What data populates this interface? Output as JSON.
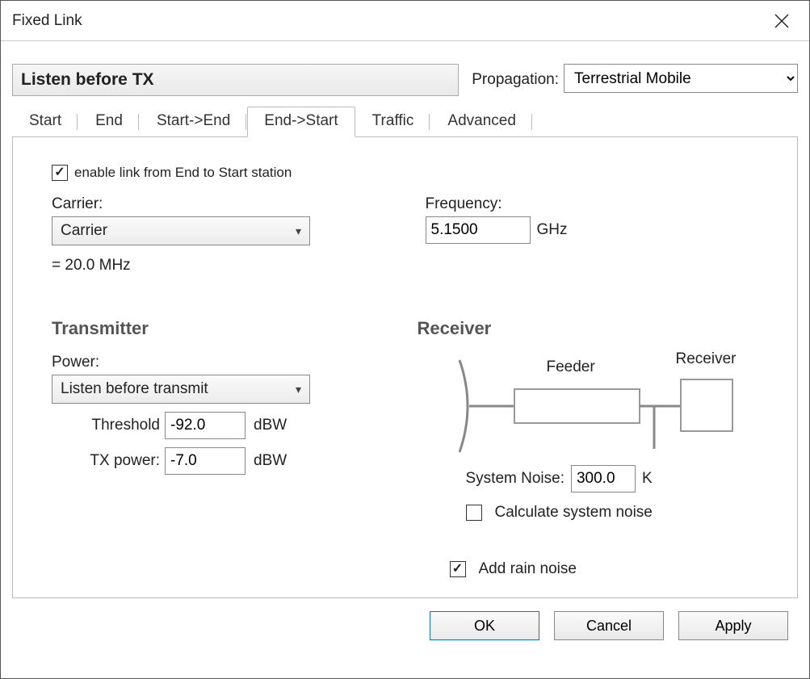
{
  "window": {
    "title": "Fixed Link"
  },
  "header": {
    "link_name": "Listen before TX",
    "propagation_label": "Propagation:",
    "propagation_value": "Terrestrial Mobile"
  },
  "tabs": [
    {
      "label": "Start"
    },
    {
      "label": "End"
    },
    {
      "label": "Start->End"
    },
    {
      "label": "End->Start"
    },
    {
      "label": "Traffic"
    },
    {
      "label": "Advanced"
    }
  ],
  "active_tab": 3,
  "panel": {
    "enable_label": "enable link from End to Start station",
    "enable_checked": true,
    "carrier_label": "Carrier:",
    "carrier_value": "Carrier",
    "carrier_eq": "= 20.0 MHz",
    "frequency_label": "Frequency:",
    "frequency_value": "5.1500",
    "frequency_unit": "GHz",
    "transmitter_head": "Transmitter",
    "power_label": "Power:",
    "power_value": "Listen before transmit",
    "threshold_label": "Threshold",
    "threshold_value": "-92.0",
    "threshold_unit": "dBW",
    "txpower_label": "TX power:",
    "txpower_value": "-7.0",
    "txpower_unit": "dBW",
    "receiver_head": "Receiver",
    "diag_feeder": "Feeder",
    "diag_receiver": "Receiver",
    "sysnoise_label": "System Noise:",
    "sysnoise_value": "300.0",
    "sysnoise_unit": "K",
    "calc_noise_label": "Calculate system noise",
    "calc_noise_checked": false,
    "rain_noise_label": "Add rain noise",
    "rain_noise_checked": true
  },
  "buttons": {
    "ok": "OK",
    "cancel": "Cancel",
    "apply": "Apply"
  }
}
